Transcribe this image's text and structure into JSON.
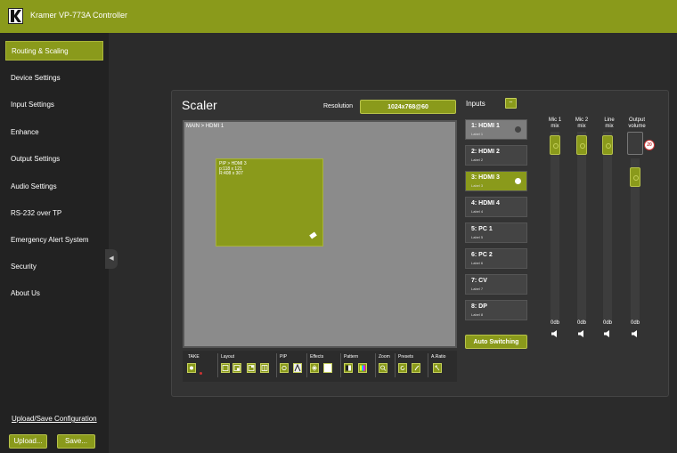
{
  "app": {
    "title": "Kramer VP-773A Controller",
    "logo_letter": "K"
  },
  "sidebar": {
    "items": [
      {
        "label": "Routing & Scaling"
      },
      {
        "label": "Device Settings"
      },
      {
        "label": "Input Settings"
      },
      {
        "label": "Enhance"
      },
      {
        "label": "Output Settings"
      },
      {
        "label": "Audio Settings"
      },
      {
        "label": "RS-232 over TP"
      },
      {
        "label": "Emergency Alert System"
      },
      {
        "label": "Security"
      },
      {
        "label": "About Us"
      }
    ],
    "active_index": 0,
    "collapse_glyph": "◀",
    "upload_save_link": "Upload/Save Configuration",
    "upload_button": "Upload...",
    "save_button": "Save..."
  },
  "scaler": {
    "title": "Scaler",
    "resolution_label": "Resolution",
    "resolution_value": "1024x768@60",
    "main_label": "MAIN > HDMI 1",
    "pip_line1": "PIP > HDMI 3",
    "pip_line2": "p:118 x 121",
    "pip_line3": "R:408 x 307"
  },
  "toolbar": {
    "take": "TAKE",
    "layout": "Layout",
    "pip": "PIP",
    "effects": "Effects",
    "pattern": "Pattern",
    "zoom": "Zoom",
    "presets": "Presets",
    "aratio": "A.Ratio"
  },
  "inputs": {
    "title": "Inputs",
    "swap_glyph": "⇔",
    "items": [
      {
        "name": "1: HDMI 1",
        "label": "Label 1"
      },
      {
        "name": "2: HDMI 2",
        "label": "Label 2"
      },
      {
        "name": "3: HDMI 3",
        "label": "Label 3"
      },
      {
        "name": "4: HDMI 4",
        "label": "Label 4"
      },
      {
        "name": "5: PC 1",
        "label": "Label 5"
      },
      {
        "name": "6: PC 2",
        "label": "Label 6"
      },
      {
        "name": "7: CV",
        "label": "Label 7"
      },
      {
        "name": "8: DP",
        "label": "Label 8"
      }
    ],
    "auto_switching": "Auto Switching"
  },
  "audio": {
    "mic1": {
      "line1": "Mic 1",
      "line2": "mix",
      "db": "0db"
    },
    "mic2": {
      "line1": "Mic 2",
      "line2": "mix",
      "db": "0db"
    },
    "line": {
      "line1": "Line",
      "line2": "mix",
      "db": "0db"
    },
    "output": {
      "line1": "Output",
      "line2": "volume",
      "db": "0db",
      "badge": "20"
    }
  },
  "colors": {
    "accent": "#8a9a1b",
    "background": "#2b2b2b",
    "sidebar": "#222222",
    "panel": "#333333"
  }
}
